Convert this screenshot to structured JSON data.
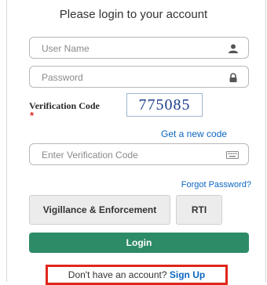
{
  "title": "Please login to your account",
  "username": {
    "placeholder": "User Name",
    "icon": "user-icon"
  },
  "password": {
    "placeholder": "Password",
    "icon": "lock-icon"
  },
  "verification": {
    "label": "Verification Code",
    "required_mark": "*",
    "captcha": "775085",
    "new_code_link": "Get a new code",
    "input_placeholder": "Enter Verification Code",
    "icon": "keyboard-icon"
  },
  "forgot_password": "Forgot Password?",
  "buttons": {
    "vigilance": "Vigillance & Enforcement",
    "rti": "RTI",
    "login": "Login"
  },
  "signup": {
    "prompt": "Don't have an account?",
    "link": "Sign Up"
  },
  "colors": {
    "primary": "#2e8b68",
    "link": "#0b67c2",
    "highlight": "#e0261b"
  }
}
